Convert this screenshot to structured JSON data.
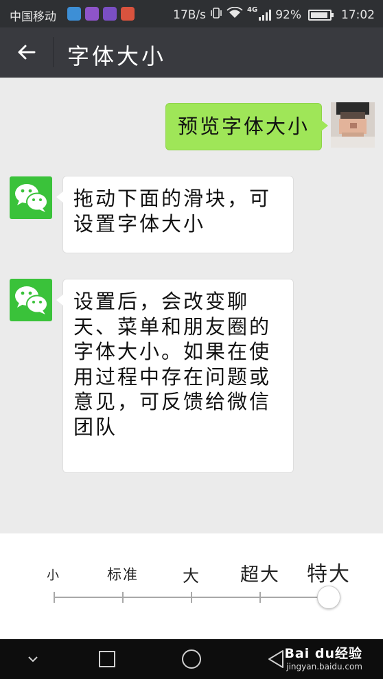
{
  "status_bar": {
    "carrier": "中国移动",
    "app_icons": [
      {
        "name": "weather-app-icon",
        "color": "#3d8fd6"
      },
      {
        "name": "gallery-app-icon",
        "color": "#8e54c9"
      },
      {
        "name": "keyboard-app-icon",
        "color": "#7a4fc4"
      },
      {
        "name": "tool-app-icon",
        "color": "#d9533e"
      }
    ],
    "net_speed": "17B/s",
    "network_type": "4G",
    "battery_percent": "92%",
    "battery_level": 0.92,
    "time": "17:02"
  },
  "title_bar": {
    "title": "字体大小"
  },
  "chat": {
    "preview_message": "预览字体大小",
    "message_1": "拖动下面的滑块，可设置字体大小",
    "message_2": "设置后，会改变聊天、菜单和朋友圈的字体大小。如果在使用过程中存在问题或意见，可反馈给微信团队"
  },
  "font_slider": {
    "options": [
      "小",
      "标准",
      "大",
      "超大",
      "特大"
    ],
    "selected_index": 4
  },
  "watermark": {
    "brand": "Bai du经验",
    "url": "jingyan.baidu.com"
  },
  "colors": {
    "sent_bubble": "#9fe658",
    "wechat_green": "#3ac23a",
    "title_bar": "#393a3f"
  }
}
